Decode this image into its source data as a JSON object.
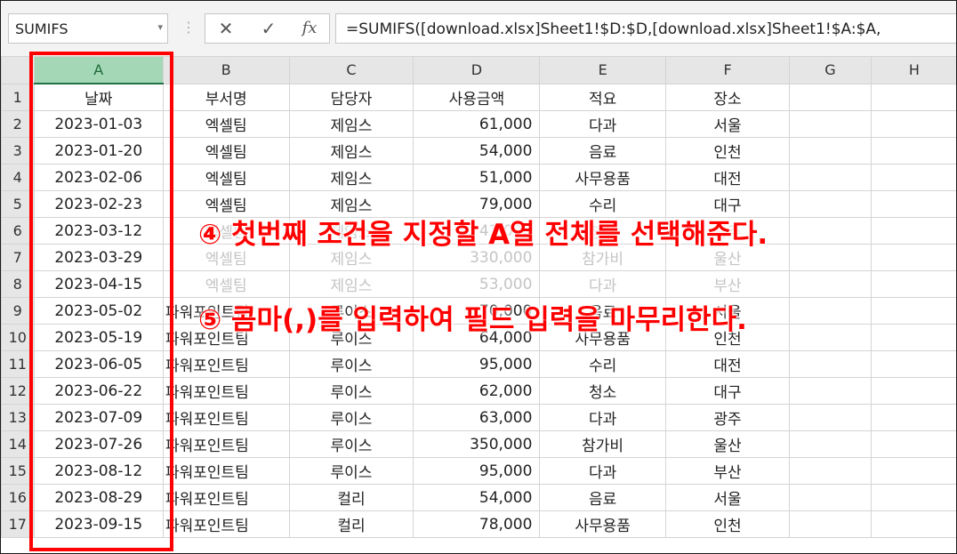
{
  "formula_bar": {
    "name_box": "SUMIFS",
    "name_box_arrow": "▾",
    "separator": "⋮",
    "cancel_icon": "✕",
    "enter_icon": "✓",
    "fx_label": "fx",
    "formula": "=SUMIFS([download.xlsx]Sheet1!$D:$D,[download.xlsx]Sheet1!$A:$A,"
  },
  "columns": [
    "A",
    "B",
    "C",
    "D",
    "E",
    "F",
    "G",
    "H"
  ],
  "selected_column": "A",
  "headers": [
    "날짜",
    "부서명",
    "담당자",
    "사용금액",
    "적요",
    "장소"
  ],
  "rows": [
    {
      "num": "2",
      "cells": [
        "2023-01-03",
        "엑셀팀",
        "제임스",
        "61,000",
        "다과",
        "서울"
      ]
    },
    {
      "num": "3",
      "cells": [
        "2023-01-20",
        "엑셀팀",
        "제임스",
        "54,000",
        "음료",
        "인천"
      ]
    },
    {
      "num": "4",
      "cells": [
        "2023-02-06",
        "엑셀팀",
        "제임스",
        "51,000",
        "사무용품",
        "대전"
      ]
    },
    {
      "num": "5",
      "cells": [
        "2023-02-23",
        "엑셀팀",
        "제임스",
        "79,000",
        "수리",
        "대구"
      ]
    },
    {
      "num": "6",
      "cells": [
        "2023-03-12",
        "엑셀팀",
        "제임스",
        "41,000",
        "청소",
        "광주"
      ]
    },
    {
      "num": "7",
      "cells": [
        "2023-03-29",
        "엑셀팀",
        "제임스",
        "330,000",
        "참가비",
        "울산"
      ]
    },
    {
      "num": "8",
      "cells": [
        "2023-04-15",
        "엑셀팀",
        "제임스",
        "53,000",
        "다과",
        "부산"
      ]
    },
    {
      "num": "9",
      "cells": [
        "2023-05-02",
        "파워포인트팀",
        "루이스",
        "70,000",
        "음료",
        "서울"
      ]
    },
    {
      "num": "10",
      "cells": [
        "2023-05-19",
        "파워포인트팀",
        "루이스",
        "64,000",
        "사무용품",
        "인천"
      ]
    },
    {
      "num": "11",
      "cells": [
        "2023-06-05",
        "파워포인트팀",
        "루이스",
        "95,000",
        "수리",
        "대전"
      ]
    },
    {
      "num": "12",
      "cells": [
        "2023-06-22",
        "파워포인트팀",
        "루이스",
        "62,000",
        "청소",
        "대구"
      ]
    },
    {
      "num": "13",
      "cells": [
        "2023-07-09",
        "파워포인트팀",
        "루이스",
        "63,000",
        "다과",
        "광주"
      ]
    },
    {
      "num": "14",
      "cells": [
        "2023-07-26",
        "파워포인트팀",
        "루이스",
        "350,000",
        "참가비",
        "울산"
      ]
    },
    {
      "num": "15",
      "cells": [
        "2023-08-12",
        "파워포인트팀",
        "루이스",
        "95,000",
        "다과",
        "부산"
      ]
    },
    {
      "num": "16",
      "cells": [
        "2023-08-29",
        "파워포인트팀",
        "컬리",
        "54,000",
        "음료",
        "서울"
      ]
    },
    {
      "num": "17",
      "cells": [
        "2023-09-15",
        "파워포인트팀",
        "컬리",
        "78,000",
        "사무용품",
        "인천"
      ]
    }
  ],
  "annotations": {
    "step4": "④ 첫번째 조건을 지정할 A열 전체를 선택해준다.",
    "step5": "⑤ 콤마(,)를 입력하여 필드 입력을 마무리한다."
  },
  "colors": {
    "annotation": "#ff0000",
    "selected_header": "#a3d7b5",
    "header_bg": "#e6e6e6"
  }
}
